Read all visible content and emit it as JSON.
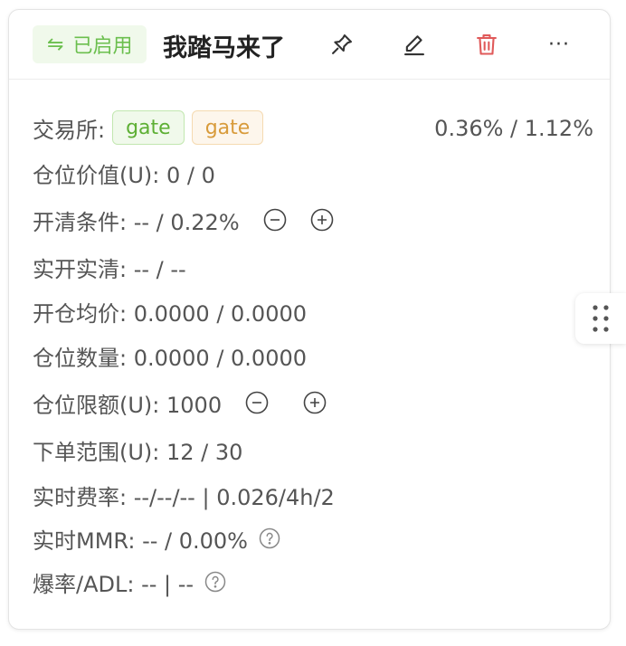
{
  "card": {
    "status_label": "已启用",
    "status_icon": "switch-icon",
    "title": "我踏马来了",
    "actions": [
      "pin-icon",
      "edit-icon",
      "delete-icon",
      "more-icon"
    ],
    "more_label": "···"
  },
  "exchange": {
    "label": "交易所:",
    "tags": [
      "gate",
      "gate"
    ],
    "ratio": "0.36% / 1.12%"
  },
  "rows": {
    "position_value": "仓位价值(U): 0 / 0",
    "open_close_condition": "开清条件: -- / 0.22%",
    "actual_open_close": "实开实清: -- / --",
    "avg_open_price": "开仓均价: 0.0000 / 0.0000",
    "position_qty": "仓位数量: 0.0000 / 0.0000",
    "position_limit": "仓位限额(U): 1000",
    "order_range": "下单范围(U): 12 / 30",
    "realtime_fee": "实时费率: --/--/-- | 0.026/4h/2",
    "realtime_mmr": "实时MMR: -- / 0.00%",
    "liq_adl": "爆率/ADL: -- | --"
  },
  "colors": {
    "enabled_green": "#6bbf4e",
    "delete_red": "#e05a5a",
    "tag_yellow": "#d89b3b"
  }
}
